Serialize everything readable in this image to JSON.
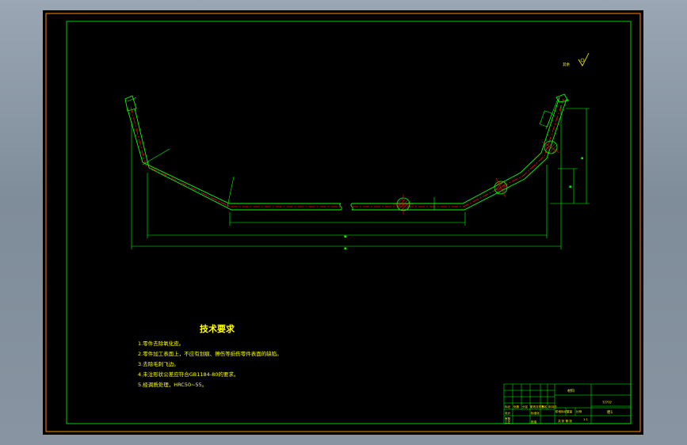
{
  "roughness": {
    "label": "其余"
  },
  "technical_requirements": {
    "title": "技术要求",
    "items": [
      "1.零件去除氧化皮。",
      "2.零件加工表面上，不应有划痕、擦伤等损伤零件表面的缺陷。",
      "3.去除毛刺飞边。",
      "4.未注形状公差应符合GB1184-80的要求。",
      "5.经调质处理，HRC50~55。"
    ]
  },
  "title_block": {
    "material": "材料",
    "drawing_number": "?????",
    "part_name": "稳1",
    "rev_headers": [
      "标记",
      "处数",
      "分区",
      "更改文件号",
      "签名",
      "年月日"
    ],
    "designer_row": [
      "设计",
      "标准化"
    ],
    "stage_header": [
      "阶段标记",
      "重量",
      "比例"
    ],
    "scale": "1:1",
    "check_row": [
      "审核"
    ],
    "process_row": [
      "工艺",
      "批准"
    ],
    "sheet_info": "共 张 第 张"
  },
  "dimensions": {
    "overall_width": "▪",
    "inner_width": "▪",
    "height_total": "▪",
    "height_partial": "▪"
  },
  "colors": {
    "outer_frame": "#ff8c00",
    "inner_frame": "#00ff00",
    "part_outline": "#00ff00",
    "centerline": "#ff0000",
    "annotation": "#ffff00",
    "background": "#000000",
    "desktop": "#8a96a3"
  }
}
